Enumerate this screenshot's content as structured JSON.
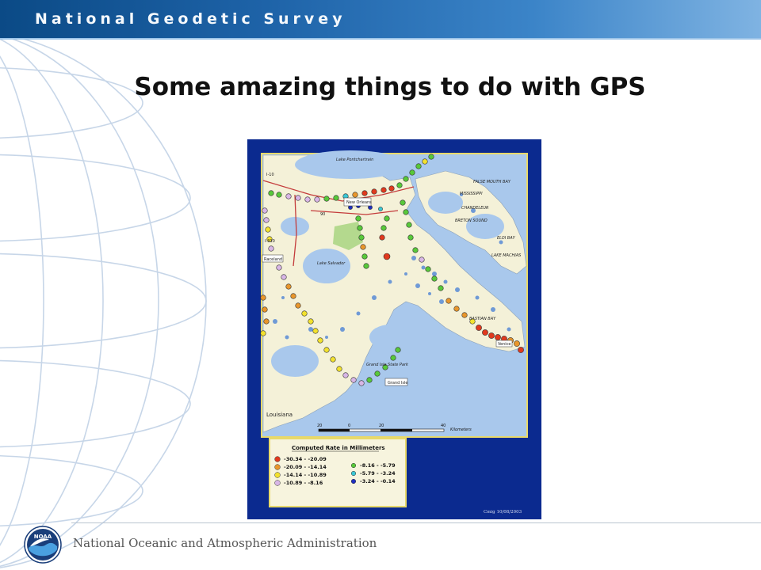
{
  "header": {
    "title": "National Geodetic Survey"
  },
  "slide": {
    "title": "Some amazing things to do with GPS"
  },
  "map": {
    "city_label": "New Orleans",
    "town_labels": [
      "Raceland",
      "Grand Isle",
      "Venice"
    ],
    "place_labels": [
      "Lake Pontchartrain",
      "Lake Salvador",
      "Grand Isle State Park",
      "Louisiana"
    ],
    "water_labels": [
      "MISSISSIPPI",
      "FALSE MOUTH BAY",
      "CHANDELEUR",
      "BRETON SOUND",
      "ELOI BAY",
      "LAKE MACHIAS",
      "BASTIAN BAY"
    ],
    "road_labels": [
      "I-10",
      "I-310",
      "90"
    ],
    "scale_bar": {
      "ticks": [
        "20",
        "0",
        "20",
        "40"
      ],
      "unit": "Kilometers"
    },
    "legend": {
      "title": "Computed Rate in Millimeters",
      "items": [
        {
          "range": "-30.34 - -20.09",
          "color": "#e03a1e"
        },
        {
          "range": "-20.09 - -14.14",
          "color": "#e8962c"
        },
        {
          "range": "-14.14 - -10.89",
          "color": "#f2e12e"
        },
        {
          "range": "-10.89 - -8.16",
          "color": "#d8b6e6"
        },
        {
          "range": "-8.16 - -5.79",
          "color": "#58c83a"
        },
        {
          "range": "-5.79 - -3.24",
          "color": "#3ac7d4"
        },
        {
          "range": "-3.24 - -0.14",
          "color": "#1f2fbf"
        }
      ]
    },
    "credit": "Cmig 10/08/2003"
  },
  "footer": {
    "agency": "National Oceanic and Atmospheric Administration",
    "logo_text": "NOAA"
  }
}
